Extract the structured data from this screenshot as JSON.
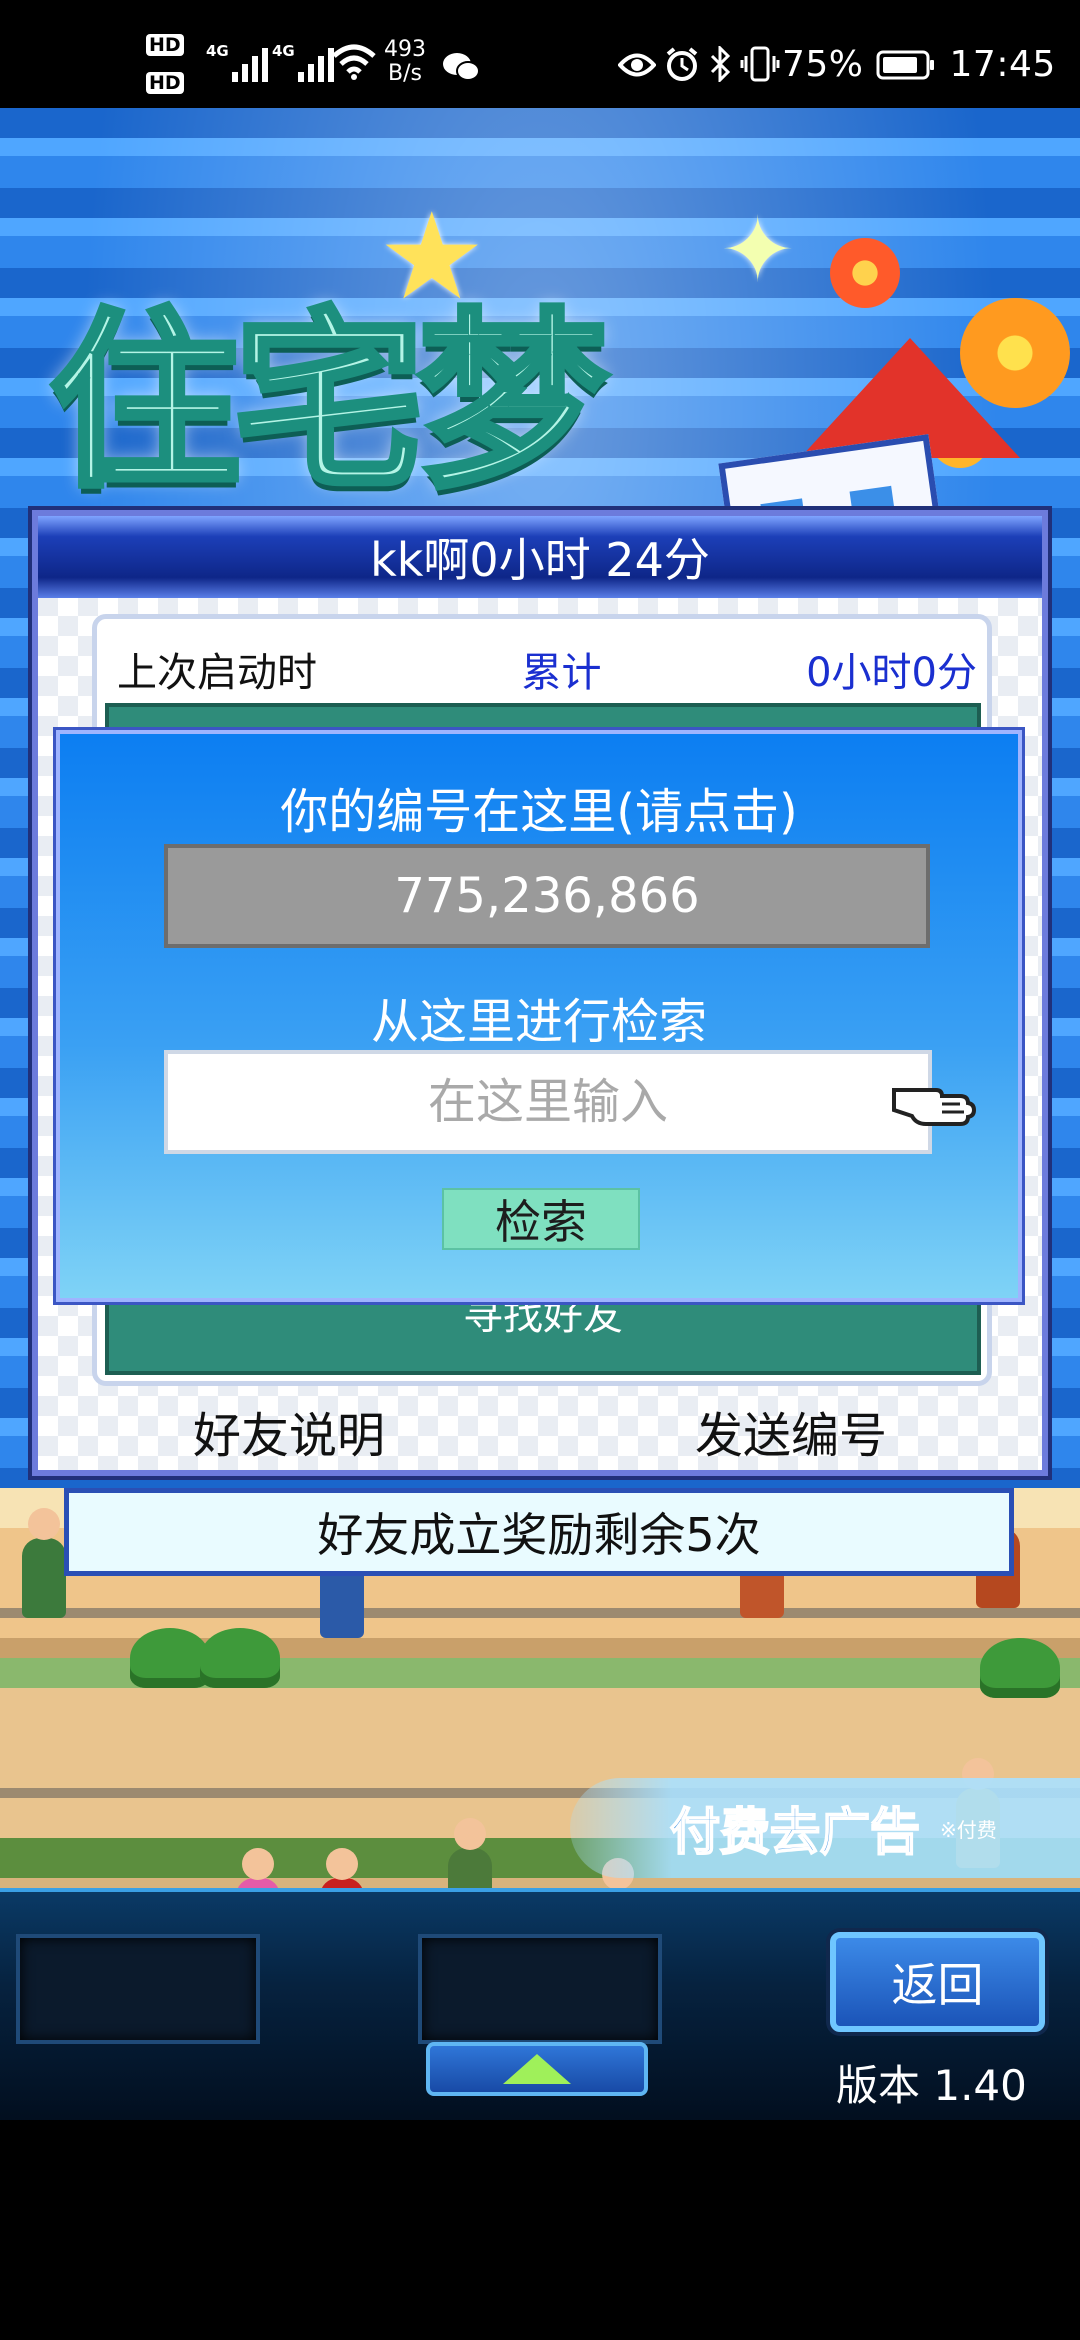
{
  "status_bar": {
    "network_speed": "493\nB/s",
    "hd1": "HD",
    "hd2": "HD",
    "net1": "4G",
    "net2": "4G",
    "battery": "75%",
    "time": "17:45"
  },
  "header": {
    "player_name": "kk啊",
    "play_time": "0小时 24分"
  },
  "stats": {
    "last_start_label": "上次启动时",
    "total_label": "累计",
    "total_value": "0小时0分"
  },
  "search_dialog": {
    "id_title": "你的编号在这里(请点击)",
    "id_value": "775,236,866",
    "search_title": "从这里进行检索",
    "search_placeholder": "在这里输入",
    "search_button": "检索"
  },
  "find_friend_label": "寻找好友",
  "footer": {
    "friend_help": "好友说明",
    "send_id": "发送编号"
  },
  "reward": {
    "label": "好友成立奖励",
    "remaining": "剩余5次"
  },
  "ad_banner": {
    "text": "付费去广告",
    "note": "※付费"
  },
  "bottom_bar": {
    "back_label": "返回",
    "version": "版本 1.40"
  },
  "colors": {
    "panel_border": "#6c7bdc",
    "dialog_top": "#0c7ef2",
    "accent_green": "#7fe0c0"
  }
}
